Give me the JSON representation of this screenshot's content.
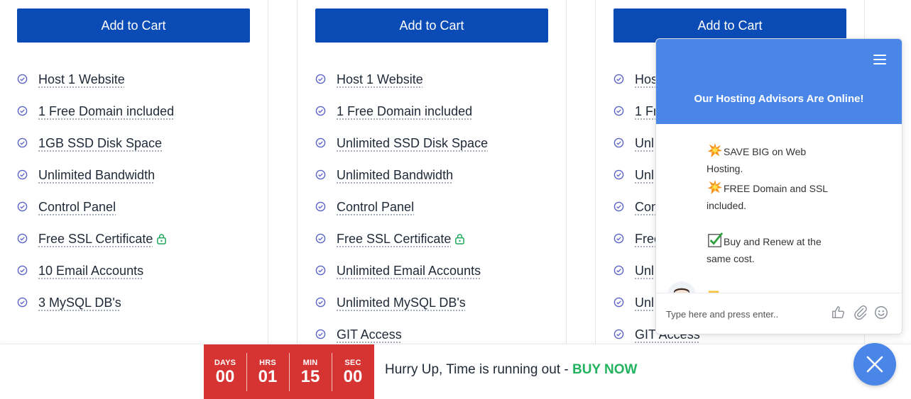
{
  "plans": [
    {
      "cart_label": "Add to Cart",
      "features": [
        "Host 1 Website",
        "1 Free Domain included",
        "1GB SSD Disk Space",
        "Unlimited Bandwidth",
        "Control Panel",
        "Free SSL Certificate",
        "10 Email Accounts",
        "3 MySQL DB's"
      ]
    },
    {
      "cart_label": "Add to Cart",
      "features": [
        "Host 1 Website",
        "1 Free Domain included",
        "Unlimited SSD Disk Space",
        "Unlimited Bandwidth",
        "Control Panel",
        "Free SSL Certificate",
        "Unlimited Email Accounts",
        "Unlimited MySQL DB's",
        "GIT Access"
      ]
    },
    {
      "cart_label": "Add to Cart",
      "features": [
        "Host",
        "1 Fr",
        "Unl",
        "Unl",
        "Con",
        "Free",
        "Unl",
        "Unl",
        "GIT Access"
      ]
    }
  ],
  "chat": {
    "title": "Our Hosting Advisors Are Online!",
    "messages": {
      "m1": "SAVE BIG on Web Hosting.",
      "m2": "FREE Domain and SSL included.",
      "m3": "Buy and Renew at the same cost."
    },
    "input_placeholder": "Type here and press enter..",
    "icons": [
      "menu-icon",
      "thumbs-up-icon",
      "paperclip-icon",
      "smiley-icon",
      "collision-emoji-icon",
      "check-mark-emoji-icon",
      "pointing-hand-emoji-icon"
    ]
  },
  "countdown": {
    "days_label": "DAYS",
    "days": "00",
    "hrs_label": "HRS",
    "hrs": "01",
    "min_label": "MIN",
    "min": "15",
    "sec_label": "SEC",
    "sec": "00"
  },
  "promo": {
    "text": "Hurry Up, Time is running out - ",
    "cta": "BUY NOW"
  },
  "colors": {
    "cart_button": "#0a4bb6",
    "chat_header": "#4a86e8",
    "countdown_bg": "#d63333",
    "buy_now": "#22b35e",
    "lock_green": "#1fa85a",
    "check_purple": "#5a63c9"
  }
}
